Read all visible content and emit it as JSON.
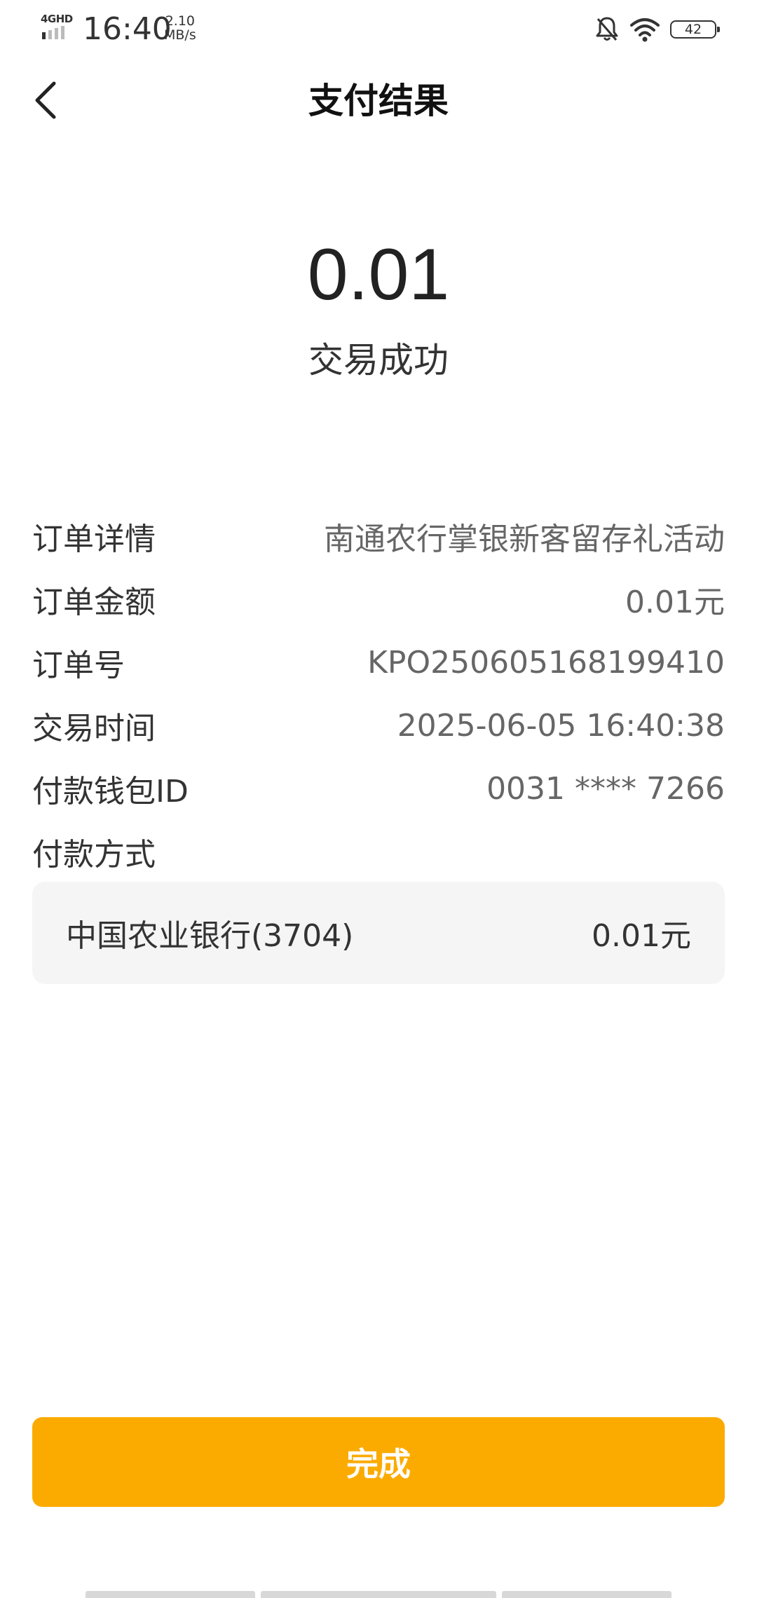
{
  "status_bar": {
    "network": "4GHD",
    "time": "16:40",
    "speed_value": "2.10",
    "speed_unit": "MB/s",
    "battery": "42",
    "icons": [
      "bell-off-icon",
      "wifi-icon",
      "battery-icon"
    ]
  },
  "header": {
    "title": "支付结果",
    "back_icon": "chevron-left-icon"
  },
  "result": {
    "amount": "0.01",
    "status": "交易成功"
  },
  "details": [
    {
      "label": "订单详情",
      "value": "南通农行掌银新客留存礼活动"
    },
    {
      "label": "订单金额",
      "value": "0.01元"
    },
    {
      "label": "订单号",
      "value": "KPO250605168199410"
    },
    {
      "label": "交易时间",
      "value": "2025-06-05 16:40:38"
    },
    {
      "label": "付款钱包ID",
      "value": "0031 **** 7266"
    },
    {
      "label": "付款方式",
      "value": ""
    }
  ],
  "payment_method": {
    "bank": "中国农业银行(3704)",
    "amount": "0.01元"
  },
  "done_button": {
    "label": "完成",
    "color": "#fbab00"
  }
}
